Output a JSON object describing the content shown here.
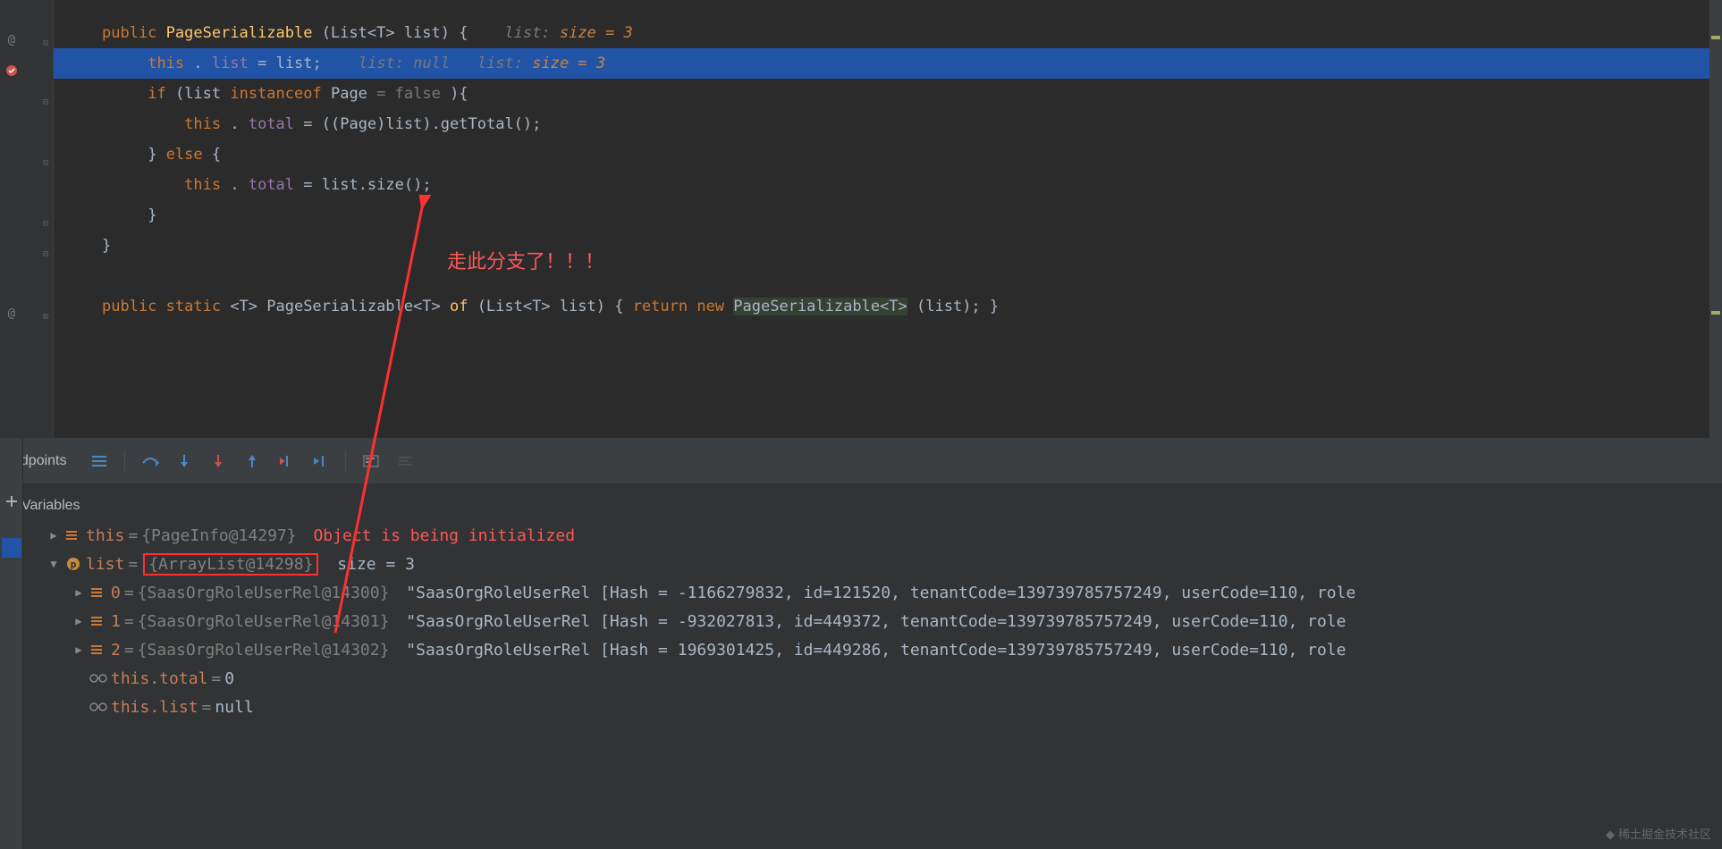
{
  "code": {
    "line1": {
      "kw1": "public",
      "method": "PageSerializable",
      "sig": "(List<T> list) { ",
      "hint1": "list: ",
      "hint2": " size = 3"
    },
    "line2": {
      "kw1": "this",
      "dot": ".",
      "field": "list",
      "eq": " = list; ",
      "hint1": "list: null ",
      "hint2": " list: ",
      "hint3": " size = 3"
    },
    "line3": {
      "kw1": "if",
      "open": "(list ",
      "kw2": "instanceof",
      "type": " Page ",
      "hint": "= false",
      "close": " ){"
    },
    "line4": {
      "kw1": "this",
      "dot": ".",
      "field": "total",
      "rest": " = ((Page)list).getTotal();"
    },
    "line5": {
      "close": "} ",
      "kw1": "else",
      "open": " {"
    },
    "line6": {
      "kw1": "this",
      "dot": ".",
      "field": "total",
      "rest": " = list.size();"
    },
    "line7": {
      "close": "}"
    },
    "line8": {
      "close": "}"
    },
    "line10": {
      "kw1": "public static",
      "generic": " <T> PageSerializable<T> ",
      "method": "of",
      "sig": "(List<T> list) { ",
      "kw2": "return new",
      "type": " PageSerializable<T>",
      "rest": "(list); }"
    }
  },
  "annotation": "走此分支了！！！",
  "debugger": {
    "tab": "ndpoints",
    "variables_title": "Variables",
    "vars": {
      "this": {
        "name": "this",
        "type": "{PageInfo@14297}",
        "warn": "Object is being initialized"
      },
      "list": {
        "name": "list",
        "type": "{ArrayList@14298}",
        "size": "size = 3"
      },
      "item0": {
        "idx": "0",
        "type": "{SaasOrgRoleUserRel@14300}",
        "val": "\"SaasOrgRoleUserRel [Hash = -1166279832, id=121520, tenantCode=139739785757249, userCode=110, role"
      },
      "item1": {
        "idx": "1",
        "type": "{SaasOrgRoleUserRel@14301}",
        "val": "\"SaasOrgRoleUserRel [Hash = -932027813, id=449372, tenantCode=139739785757249, userCode=110, role"
      },
      "item2": {
        "idx": "2",
        "type": "{SaasOrgRoleUserRel@14302}",
        "val": "\"SaasOrgRoleUserRel [Hash = 1969301425, id=449286, tenantCode=139739785757249, userCode=110, role"
      },
      "total": {
        "name": "this.total",
        "val": "0"
      },
      "thislist": {
        "name": "this.list",
        "val": "null"
      }
    }
  },
  "watermark": "稀土掘金技术社区"
}
